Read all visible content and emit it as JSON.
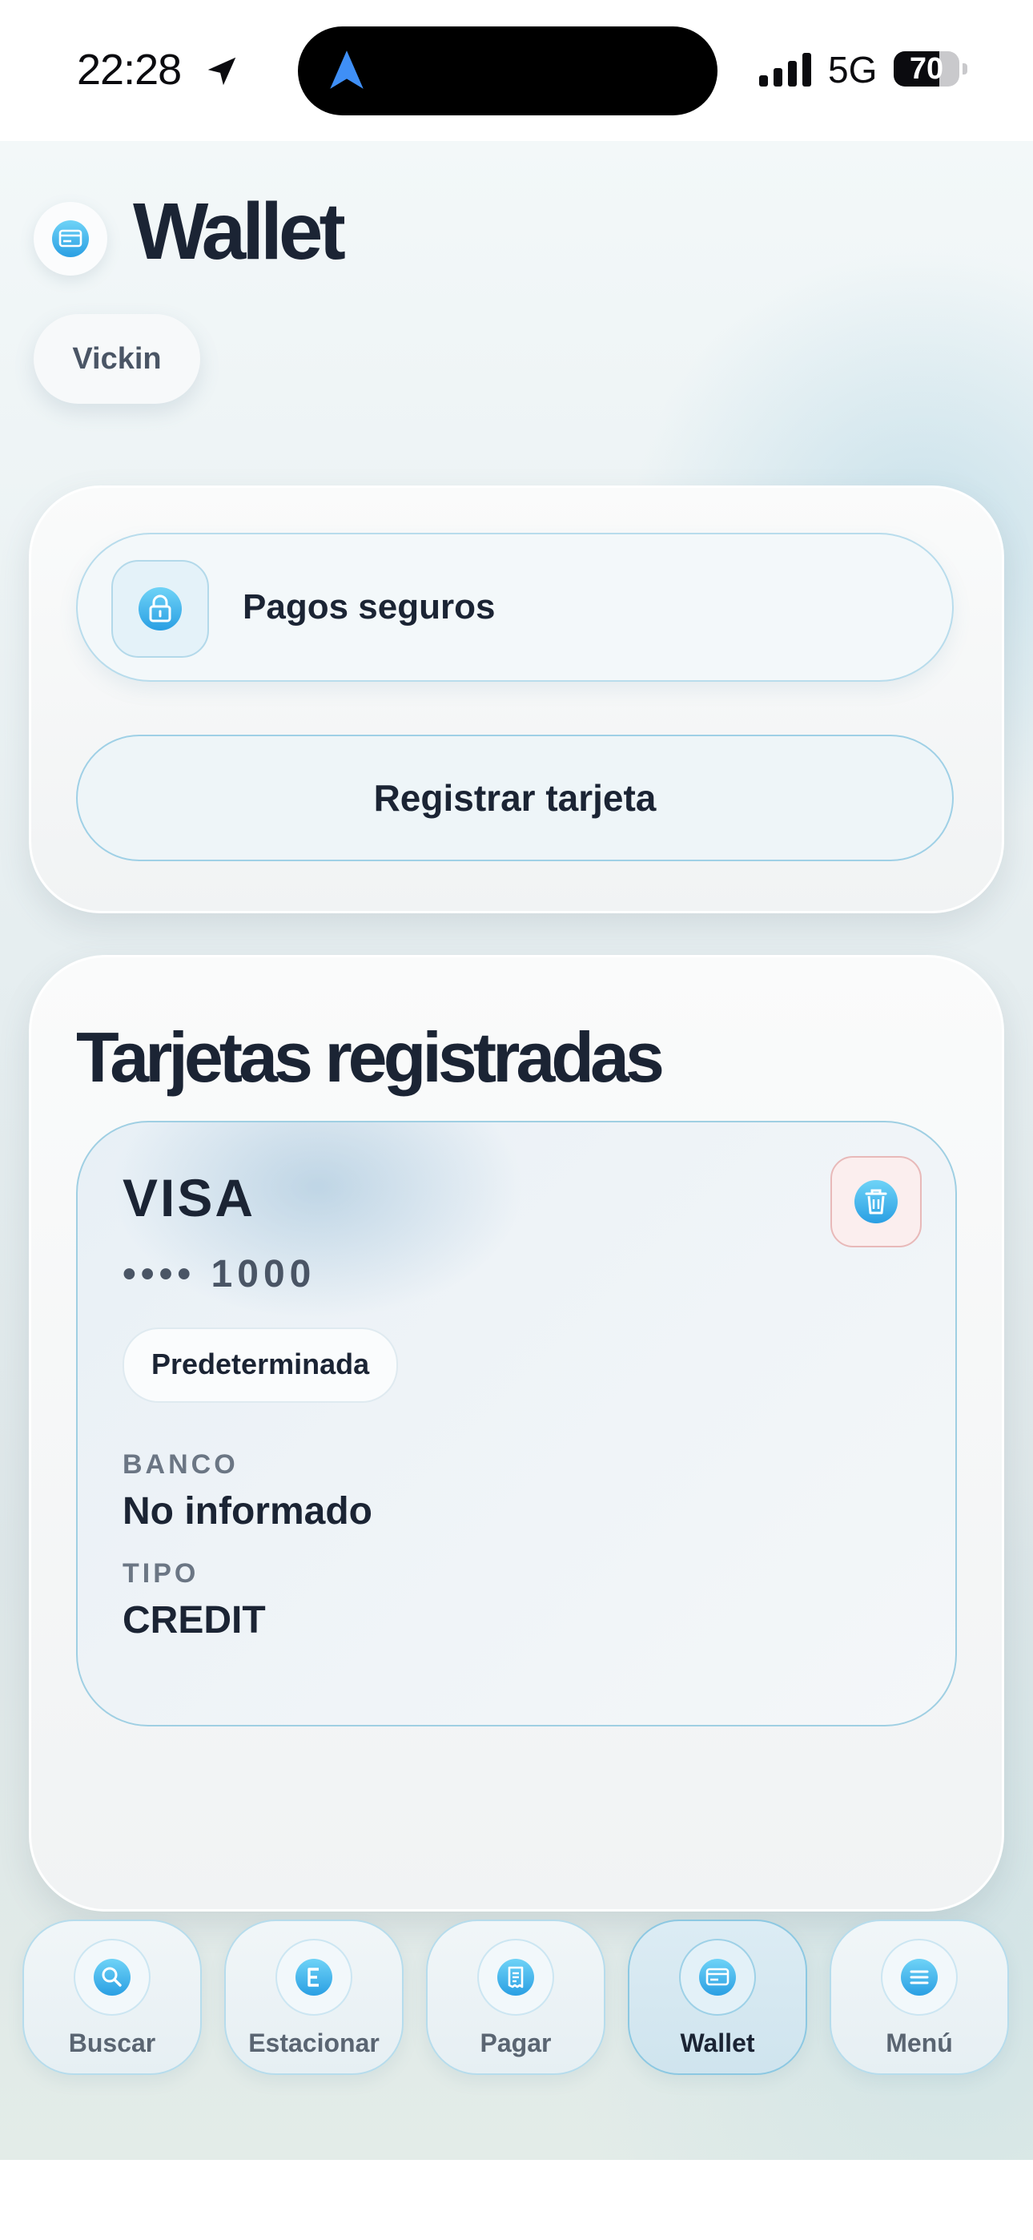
{
  "status_bar": {
    "time": "22:28",
    "network": "5G",
    "battery": "70",
    "battery_level": 0.7
  },
  "header": {
    "title": "Wallet",
    "user": "Vickin",
    "icon": "wallet-card-icon"
  },
  "actions": {
    "secure_label": "Pagos seguros",
    "register_label": "Registrar tarjeta"
  },
  "cards_section": {
    "title": "Tarjetas registradas",
    "cards": [
      {
        "brand": "VISA",
        "number": "•••• 1000",
        "badge": "Predeterminada",
        "bank_label": "BANCO",
        "bank_value": "No informado",
        "type_label": "TIPO",
        "type_value": "CREDIT"
      }
    ]
  },
  "tabs": [
    {
      "label": "Buscar",
      "icon": "search-icon",
      "active": false
    },
    {
      "label": "Estacionar",
      "icon": "parking-e-icon",
      "active": false
    },
    {
      "label": "Pagar",
      "icon": "receipt-icon",
      "active": false
    },
    {
      "label": "Wallet",
      "icon": "wallet-card-icon",
      "active": true
    },
    {
      "label": "Menú",
      "icon": "menu-icon",
      "active": false
    }
  ],
  "colors": {
    "accent": "#2ba3e4",
    "accent_light": "#58c6f2",
    "text": "#1b2434",
    "danger_bg": "#fbeeee"
  }
}
